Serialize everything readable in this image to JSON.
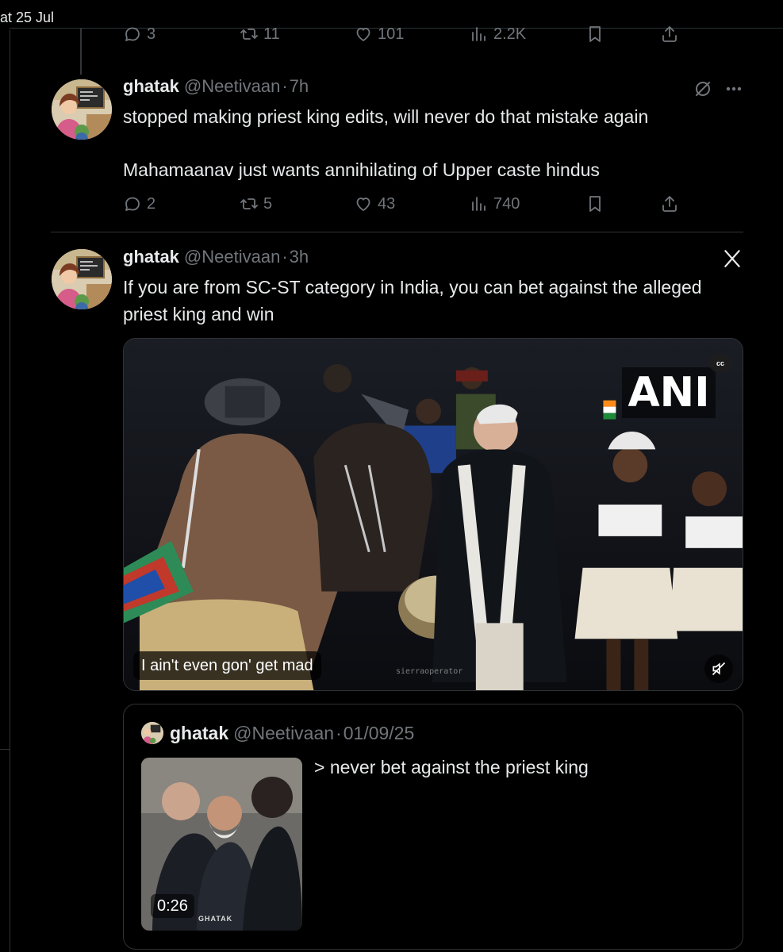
{
  "top": {
    "date_label": "at 25 Jul"
  },
  "previous_actions": {
    "replies": "3",
    "reposts": "11",
    "likes": "101",
    "views": "2.2K"
  },
  "tweet1": {
    "name": "ghatak",
    "handle": "@Neetivaan",
    "separator": "·",
    "time": "7h",
    "text_line1": "stopped making priest king edits, will never do that mistake again",
    "text_line2": "Mahamaanav just wants annihilating of Upper caste hindus",
    "actions": {
      "replies": "2",
      "reposts": "5",
      "likes": "43",
      "views": "740"
    }
  },
  "tweet2": {
    "name": "ghatak",
    "handle": "@Neetivaan",
    "separator": "·",
    "time": "3h",
    "text": "If you are from SC-ST category in India, you can bet against the alleged priest king and win",
    "video": {
      "channel_logo": "ANI",
      "cc_label": "cc",
      "caption": "I ain't even gon' get mad",
      "watermark": "sierraoperator"
    }
  },
  "quote": {
    "name": "ghatak",
    "handle": "@Neetivaan",
    "separator": "·",
    "date": "01/09/25",
    "text": "> never bet against the priest king",
    "duration": "0:26",
    "thumb_logo": "GHATAK"
  },
  "colors": {
    "background": "#000000",
    "text": "#e7e9ea",
    "muted": "#71767b",
    "border": "#2f3336"
  },
  "icons": [
    "reply-icon",
    "repost-icon",
    "like-icon",
    "views-icon",
    "bookmark-icon",
    "share-icon",
    "grok-icon",
    "more-icon",
    "close-icon",
    "mute-icon"
  ]
}
